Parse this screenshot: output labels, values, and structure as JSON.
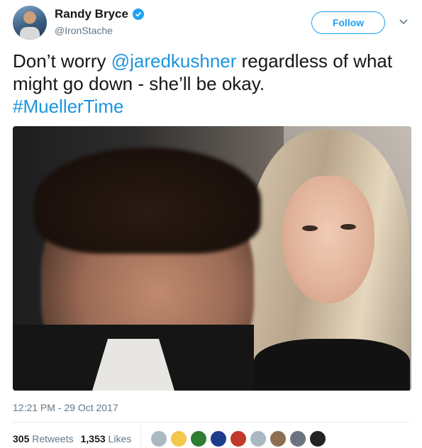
{
  "author": {
    "display_name": "Randy Bryce",
    "handle": "@IronStache",
    "verified": true
  },
  "follow_button": {
    "label": "Follow"
  },
  "tweet": {
    "text_plain_1": "Don’t worry ",
    "mention": "@jaredkushner",
    "text_plain_2": " regardless of what might go down - she’ll be okay.",
    "hashtag": "#MuellerTime"
  },
  "timestamp": "12:21 PM - 29 Oct 2017",
  "stats": {
    "retweets_count": "305",
    "retweets_label": "Retweets",
    "likes_count": "1,353",
    "likes_label": "Likes"
  },
  "likers": [
    {
      "color": "#aab8c2"
    },
    {
      "color": "#f2c94c"
    },
    {
      "color": "#2e7d32"
    },
    {
      "color": "#1e3a8a"
    },
    {
      "color": "#c0392b"
    },
    {
      "color": "#aab8c2"
    },
    {
      "color": "#8e6e53"
    },
    {
      "color": "#6b7280"
    },
    {
      "color": "#222222"
    }
  ],
  "colors": {
    "accent": "#1da1f2",
    "link": "#1b95e0",
    "secondary_text": "#657786"
  }
}
